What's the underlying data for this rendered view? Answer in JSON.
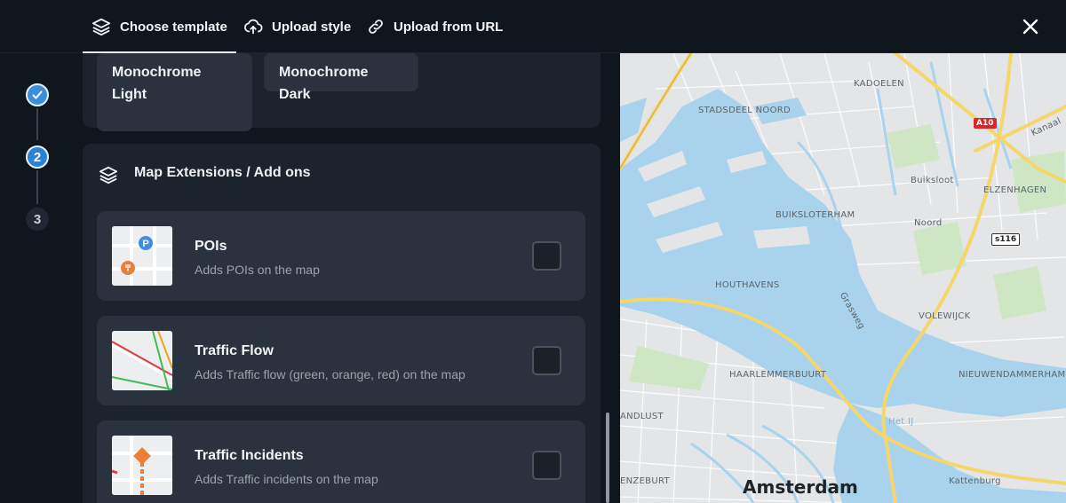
{
  "topbar": {
    "tabs": [
      {
        "label": "Choose template",
        "icon": "layers-icon",
        "active": true
      },
      {
        "label": "Upload style",
        "icon": "cloud-upload-icon"
      },
      {
        "label": "Upload from URL",
        "icon": "link-icon"
      }
    ],
    "close_icon": "close-icon"
  },
  "stepper": {
    "steps": [
      {
        "state": "done",
        "label": ""
      },
      {
        "state": "active",
        "label": "2"
      },
      {
        "state": "todo",
        "label": "3"
      }
    ]
  },
  "templates": [
    {
      "label": "Monochrome Light"
    },
    {
      "label": "Monochrome Dark"
    }
  ],
  "extensions": {
    "title": "Map Extensions / Add ons",
    "icon": "layers-icon",
    "items": [
      {
        "name": "POIs",
        "desc": "Adds POIs on the map",
        "checked": false
      },
      {
        "name": "Traffic Flow",
        "desc": "Adds Traffic flow (green, orange, red) on the map",
        "checked": false
      },
      {
        "name": "Traffic Incidents",
        "desc": "Adds Traffic incidents on the map",
        "checked": false
      }
    ]
  },
  "map": {
    "labels": {
      "kadoelen": "KADOELEN",
      "stadsdeel": "STADSDEEL NOORD",
      "buiksloot": "Buiksloot",
      "elzenhagen": "ELZENHAGEN",
      "buiksloterham": "BUIKSLOTERHAM",
      "noord": "Noord",
      "houthavens": "HOUTHAVENS",
      "grasweg": "Grasweg",
      "volewijck": "VOLEWIJCK",
      "haarlemmerbuurt": "HAARLEMMERBUURT",
      "nieuwendammerham": "NIEUWENDAMMERHAM",
      "andlust": "ANDLUST",
      "het_ij": "Het IJ",
      "enzeburt": "ENZEBURT",
      "kattenburg": "Kattenburg",
      "kanaal": "Kanaal",
      "city": "Amsterdam"
    },
    "shields": {
      "a10": "A10",
      "s116": "s116"
    },
    "colors": {
      "water": "#a9d3ec",
      "land": "#e3e5e7",
      "park": "#cfe6c4",
      "highway": "#f5d66a"
    }
  }
}
